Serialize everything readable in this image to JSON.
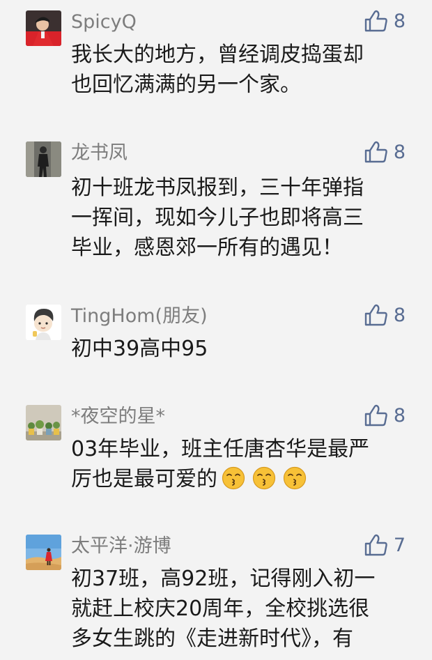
{
  "comments": [
    {
      "name": "SpicyQ",
      "likes": "8",
      "avatar_icon": "person-red-jacket-avatar",
      "lines": [
        "我长大的地方，曾经调皮捣蛋却",
        "也回忆满满的另一个家。"
      ]
    },
    {
      "name": "龙书凤",
      "likes": "8",
      "avatar_icon": "person-dark-photo-avatar",
      "lines": [
        "初十班龙书凤报到，三十年弹指",
        "一挥间，现如今儿子也即将高三",
        "毕业，感恩郊一所有的遇见！"
      ]
    },
    {
      "name": "TingHom(朋友)",
      "likes": "8",
      "avatar_icon": "cartoon-boy-avatar",
      "lines": [
        "初中39高中95"
      ]
    },
    {
      "name": "*夜空的星*",
      "likes": "8",
      "avatar_icon": "potted-plants-avatar",
      "lines": [
        "03年毕业，班主任唐杏华是最严",
        "厉也是最可爱的"
      ],
      "emojis": [
        "kissing-face-emoji",
        "kissing-face-emoji",
        "kissing-face-emoji"
      ]
    },
    {
      "name": "太平洋·游博",
      "likes": "7",
      "avatar_icon": "desert-person-avatar",
      "lines": [
        "初37班，高92班，记得刚入初一",
        "就赶上校庆20周年，全校挑选很",
        "多女生跳的《走进新时代》，有"
      ]
    }
  ],
  "colors": {
    "background": "#f3f3f3",
    "name": "#7d7d7d",
    "like": "#586c92",
    "text": "#1a1a1a"
  }
}
